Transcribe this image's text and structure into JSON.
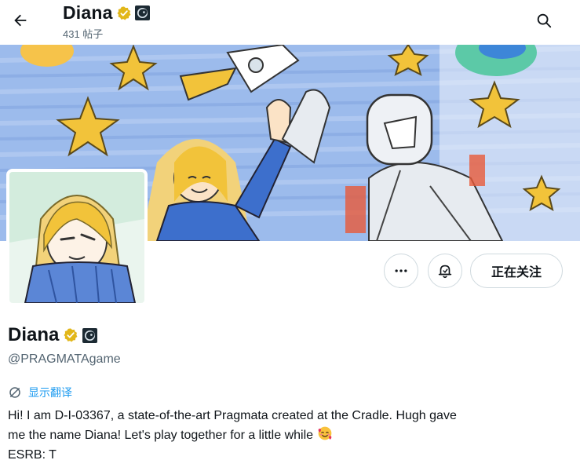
{
  "header": {
    "title": "Diana",
    "post_count": "431 帖子",
    "icons": {
      "back": "arrow-left-icon",
      "search": "search-icon",
      "verified": "verified-badge-icon",
      "affiliate": "affiliate-badge-icon"
    }
  },
  "profile": {
    "display_name": "Diana",
    "handle": "@PRAGMATAgame",
    "translate_label": "显示翻译",
    "bio_lines": [
      "Hi! I am D-I-03367, a state-of-the-art Pragmata created at the Cradle. Hugh gave",
      "me the name Diana! Let's play together for a little while",
      "ESRB: T"
    ]
  },
  "actions": {
    "more_icon": "more-icon",
    "notify_icon": "notification-bell-icon",
    "follow_label": "正在关注"
  },
  "colors": {
    "accent": "#1d9bf0",
    "text_primary": "#0f1419",
    "text_secondary": "#536471",
    "verified_gold": "#e2b719",
    "border": "#cfd9de"
  }
}
